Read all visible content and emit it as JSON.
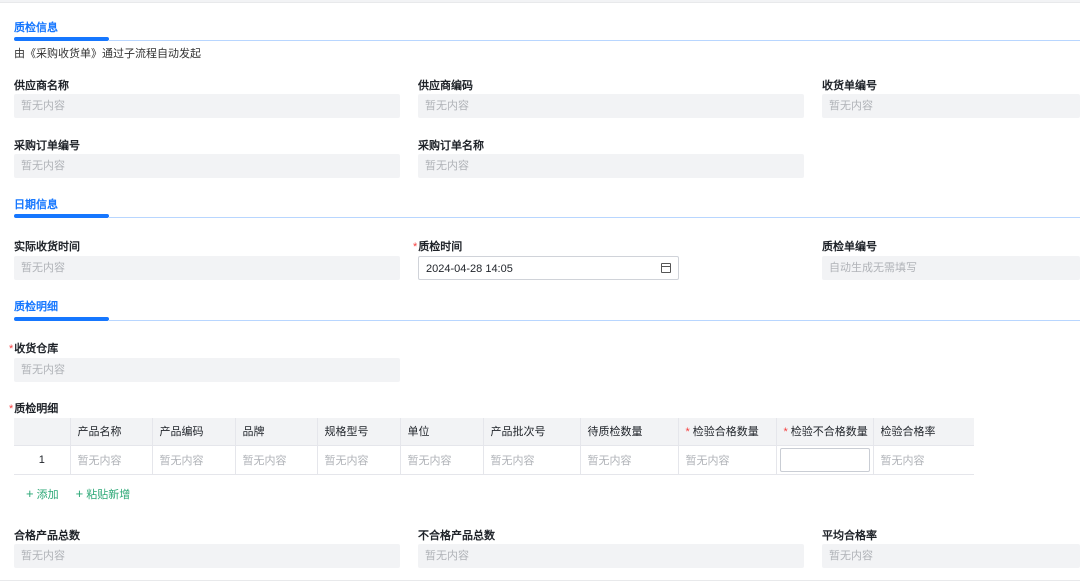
{
  "sections": {
    "qc_info": {
      "title": "质检信息",
      "subtitle": "由《采购收货单》通过子流程自动发起"
    },
    "date_info": {
      "title": "日期信息"
    },
    "qc_detail": {
      "title": "质检明细"
    }
  },
  "placeholder": "暂无内容",
  "fields": {
    "supplier_name": {
      "label": "供应商名称",
      "value": "暂无内容"
    },
    "supplier_code": {
      "label": "供应商编码",
      "value": "暂无内容"
    },
    "receipt_no": {
      "label": "收货单编号",
      "value": "暂无内容"
    },
    "po_no": {
      "label": "采购订单编号",
      "value": "暂无内容"
    },
    "po_name": {
      "label": "采购订单名称",
      "value": "暂无内容"
    },
    "actual_receipt_time": {
      "label": "实际收货时间",
      "value": "暂无内容"
    },
    "qc_time": {
      "label": "质检时间",
      "required": "*",
      "value": "2024-04-28 14:05"
    },
    "qc_no": {
      "label": "质检单编号",
      "value": "自动生成无需填写"
    },
    "warehouse": {
      "label": "收货仓库",
      "required": "*",
      "value": "暂无内容"
    },
    "detail_label": {
      "label": "质检明细",
      "required": "*"
    },
    "pass_total": {
      "label": "合格产品总数",
      "value": "暂无内容"
    },
    "fail_total": {
      "label": "不合格产品总数",
      "value": "暂无内容"
    },
    "avg_pass_rate": {
      "label": "平均合格率",
      "value": "暂无内容"
    }
  },
  "table": {
    "columns": [
      "",
      "产品名称",
      "产品编码",
      "品牌",
      "规格型号",
      "单位",
      "产品批次号",
      "待质检数量",
      "检验合格数量",
      "检验不合格数量",
      "检验合格率"
    ],
    "required_mark": "*",
    "rows": [
      {
        "index": "1",
        "cells": [
          "暂无内容",
          "暂无内容",
          "暂无内容",
          "暂无内容",
          "暂无内容",
          "暂无内容",
          "暂无内容",
          "暂无内容",
          "",
          "暂无内容"
        ]
      }
    ]
  },
  "actions": {
    "add": "添加",
    "paste_add": "粘贴新增",
    "plus_glyph": "+"
  },
  "colors": {
    "accent": "#1677ff",
    "required": "#f53f3f",
    "action": "#2aa775",
    "field_bg": "#f2f3f5"
  }
}
